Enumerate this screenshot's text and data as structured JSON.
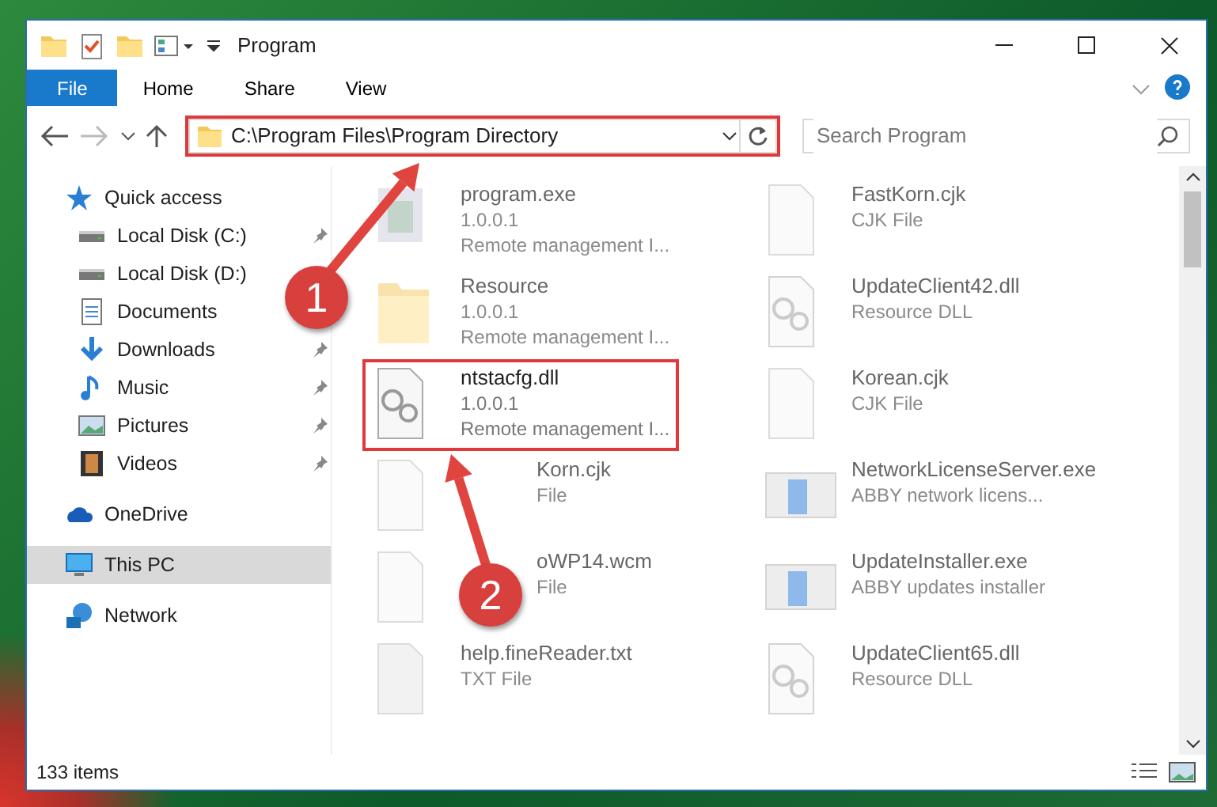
{
  "window": {
    "title": "Program"
  },
  "ribbon_tabs": [
    {
      "label": "File",
      "kind": "menu"
    },
    {
      "label": "Home",
      "kind": "tab"
    },
    {
      "label": "Share",
      "kind": "tab"
    },
    {
      "label": "View",
      "kind": "tab"
    }
  ],
  "address": {
    "path": "C:\\Program Files\\Program Directory",
    "highlighted": true
  },
  "search": {
    "placeholder": "Search Program"
  },
  "nav": [
    {
      "label": "Quick access",
      "kind": "star",
      "selected": false,
      "children": [
        {
          "label": "Local Disk (C:)",
          "kind": "drive",
          "pinned": true,
          "selected": false
        },
        {
          "label": "Local Disk (D:)",
          "kind": "drive",
          "selected": false
        },
        {
          "label": "Documents",
          "kind": "doc",
          "selected": false
        },
        {
          "label": "Downloads",
          "kind": "download",
          "pinned": true,
          "selected": false
        },
        {
          "label": "Music",
          "kind": "music",
          "pinned": true,
          "selected": false
        },
        {
          "label": "Pictures",
          "kind": "picture",
          "pinned": true,
          "selected": false
        },
        {
          "label": "Videos",
          "kind": "video",
          "pinned": true,
          "selected": false
        }
      ]
    },
    {
      "label": "OneDrive",
      "kind": "cloud",
      "selected": false
    },
    {
      "label": "This PC",
      "kind": "pc",
      "selected": true
    },
    {
      "label": "Network",
      "kind": "network",
      "selected": false
    }
  ],
  "files": [
    {
      "name": "program.exe",
      "lines": [
        "1.0.0.1",
        "Remote management I..."
      ],
      "kind": "exe",
      "blurred": true,
      "highlighted": false
    },
    {
      "name": "FastKorn.cjk",
      "lines": [
        "CJK File"
      ],
      "kind": "blank",
      "blurred": true,
      "highlighted": false
    },
    {
      "name": "Resource",
      "lines": [
        "1.0.0.1",
        "Remote management I..."
      ],
      "kind": "folder",
      "blurred": true,
      "highlighted": false
    },
    {
      "name": "UpdateClient42.dll",
      "lines": [
        "Resource DLL"
      ],
      "kind": "dll",
      "blurred": true,
      "highlighted": false
    },
    {
      "name": "ntstacfg.dll",
      "lines": [
        "1.0.0.1",
        "Remote management I..."
      ],
      "kind": "dll",
      "blurred": false,
      "highlighted": true
    },
    {
      "name": "Korean.cjk",
      "lines": [
        "CJK File"
      ],
      "kind": "blank",
      "blurred": true,
      "highlighted": false
    },
    {
      "name": "Korn.cjk",
      "lines": [
        "File"
      ],
      "kind": "blank",
      "blurred": true,
      "highlighted": false
    },
    {
      "name": "NetworkLicenseServer.exe",
      "lines": [
        "ABBY network licens..."
      ],
      "kind": "app",
      "blurred": true,
      "highlighted": false
    },
    {
      "name": "oWP14.wcm",
      "lines": [
        "File"
      ],
      "kind": "blank",
      "blurred": true,
      "highlighted": false
    },
    {
      "name": "UpdateInstaller.exe",
      "lines": [
        "ABBY updates installer"
      ],
      "kind": "app",
      "blurred": true,
      "highlighted": false
    },
    {
      "name": "help.fineReader.txt",
      "lines": [
        "TXT File"
      ],
      "kind": "text",
      "blurred": true,
      "highlighted": false
    },
    {
      "name": "UpdateClient65.dll",
      "lines": [
        "Resource DLL"
      ],
      "kind": "dll",
      "blurred": true,
      "highlighted": false
    }
  ],
  "status_bar": {
    "item_count": "133 items"
  },
  "annotations": [
    {
      "number": "1"
    },
    {
      "number": "2"
    }
  ]
}
